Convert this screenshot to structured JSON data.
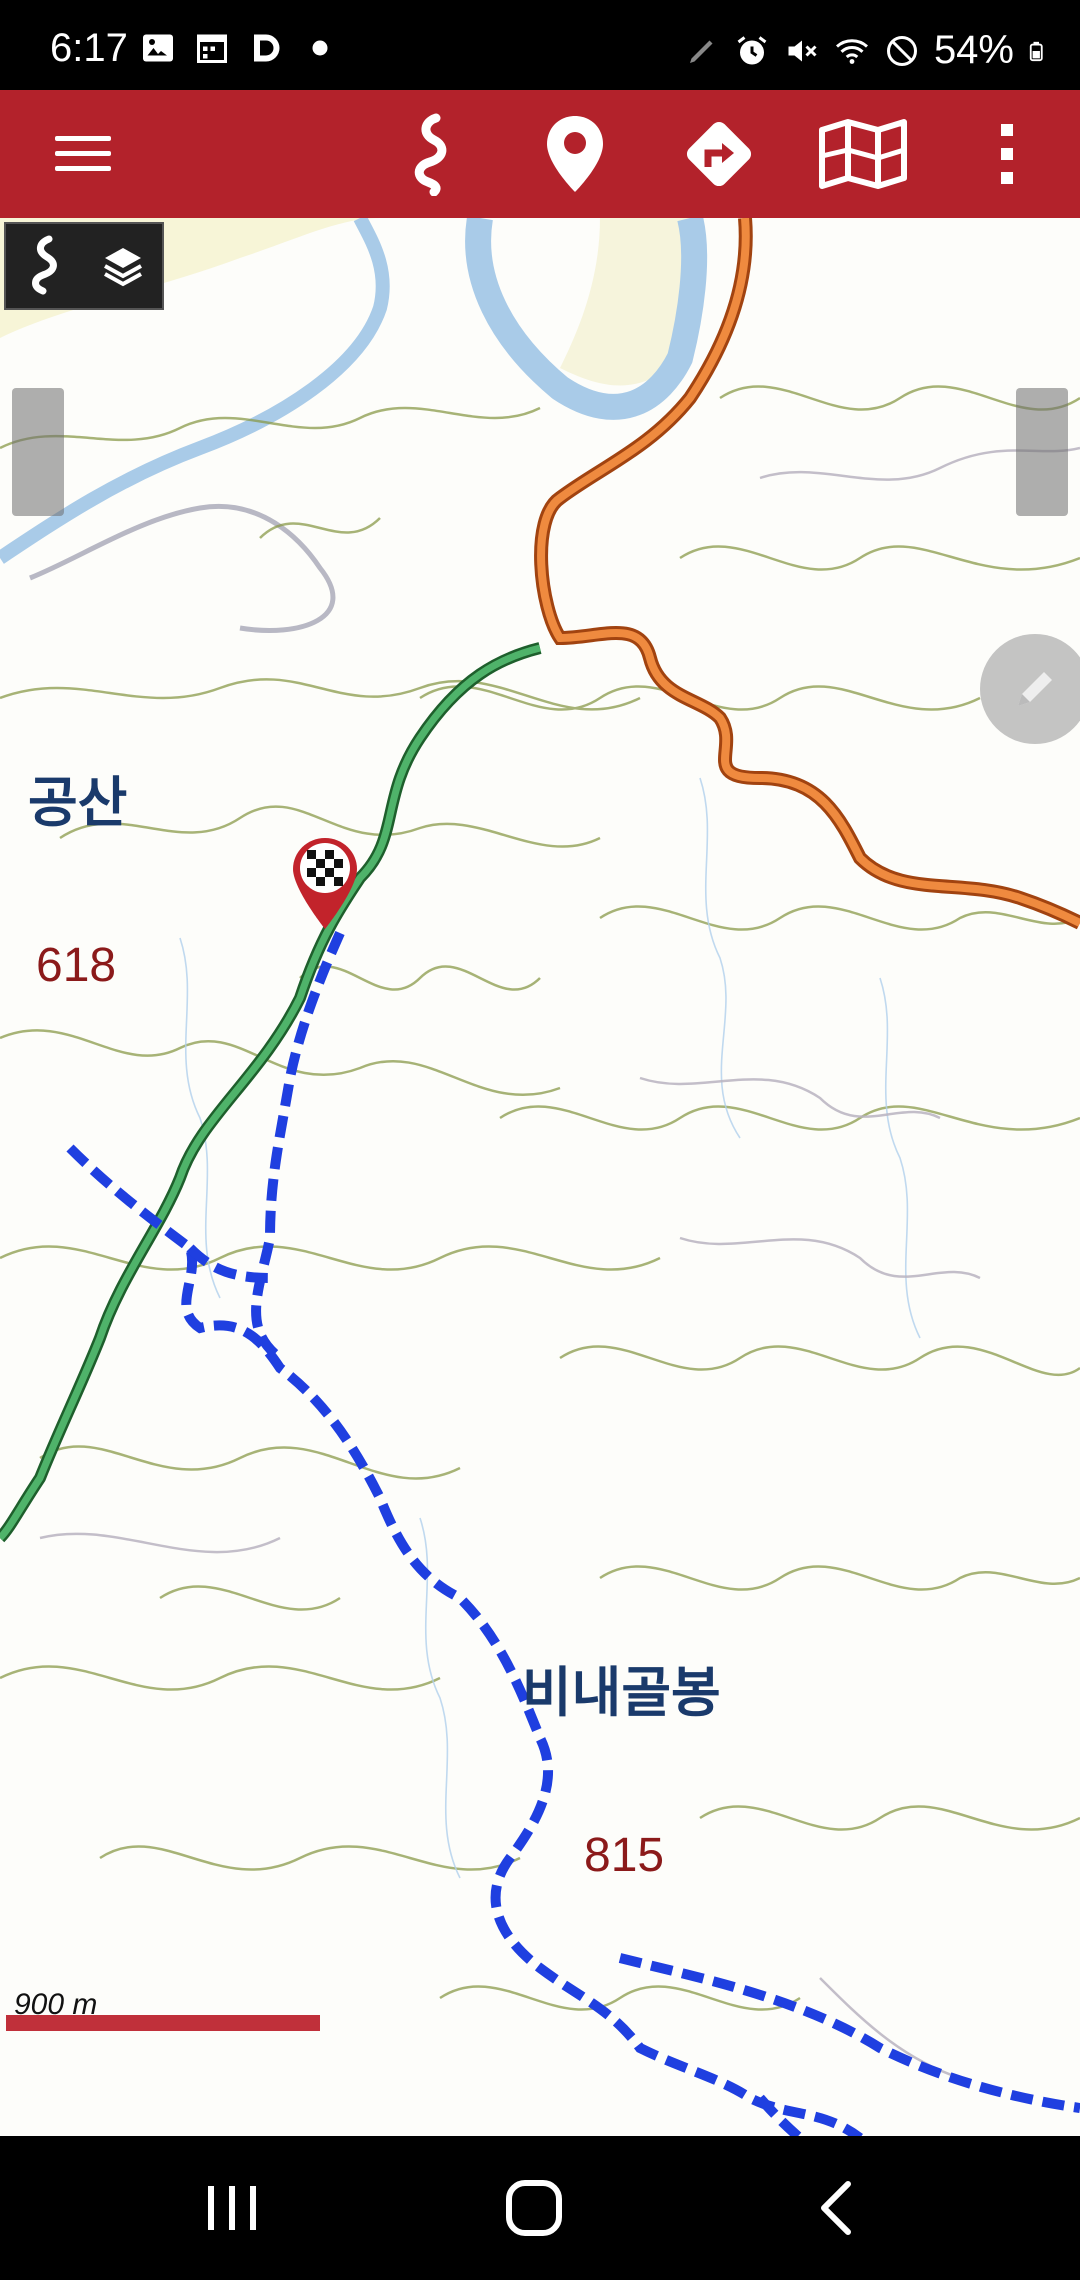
{
  "status_bar": {
    "time": "6:17",
    "battery": "54%",
    "icons": [
      "image-icon",
      "calendar-icon",
      "d-app-icon",
      "dot-icon",
      "pen-icon",
      "alarm-icon",
      "mute-icon",
      "wifi-icon",
      "dnd-icon",
      "battery-icon"
    ]
  },
  "toolbar": {
    "color": "#b3222b",
    "buttons": [
      "menu-icon",
      "track-icon",
      "location-pin-icon",
      "directions-icon",
      "map-icon",
      "more-vert-icon"
    ]
  },
  "map": {
    "labels": {
      "place1": "공산",
      "place2": "비내골봉",
      "elev1": "618",
      "elev2": "815"
    },
    "scale": {
      "label": "900 m"
    },
    "overlay_buttons": [
      "track-icon",
      "layers-icon"
    ],
    "route_color": "#1f3fe0",
    "road_orange": "#e2691f",
    "road_green": "#3a8f4a"
  },
  "nav_bar": {
    "buttons": [
      "recents-icon",
      "home-icon",
      "back-icon"
    ]
  }
}
